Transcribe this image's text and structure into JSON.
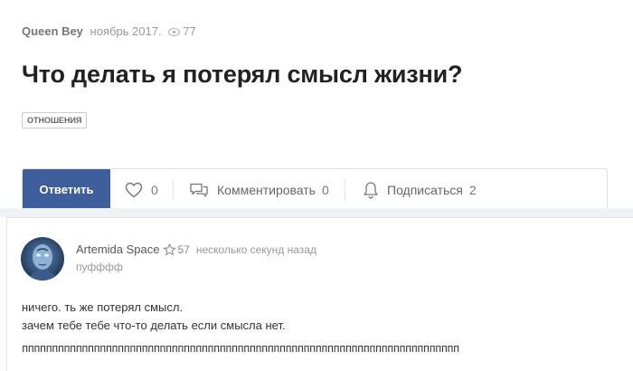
{
  "post": {
    "author": "Queen Bey",
    "date": "ноябрь 2017.",
    "views": "77",
    "title": "Что делать я потерял смысл жизни?",
    "tag": "ОТНОШЕНИЯ"
  },
  "actions": {
    "reply_label": "Ответить",
    "like_count": "0",
    "comment_label": "Комментировать",
    "comment_count": "0",
    "subscribe_label": "Подписаться",
    "subscribe_count": "2"
  },
  "comment": {
    "author": "Artemida Space",
    "rating": "57",
    "time": "несколько секунд назад",
    "status": "пуфффф",
    "line1": "ничего. ть же потерял смысл.",
    "line2": "зачем тебе тебе что-то делать если смысла нет.",
    "line3": "ппппппппппппппппппппппппппппппппппппппппппппппппппппппппппппппппппппппппп"
  },
  "colors": {
    "accent": "#3f5f9c",
    "background_band": "#f0f2f5"
  },
  "icons": [
    "eye-icon",
    "heart-icon",
    "comment-icon",
    "bell-icon",
    "star-icon"
  ]
}
